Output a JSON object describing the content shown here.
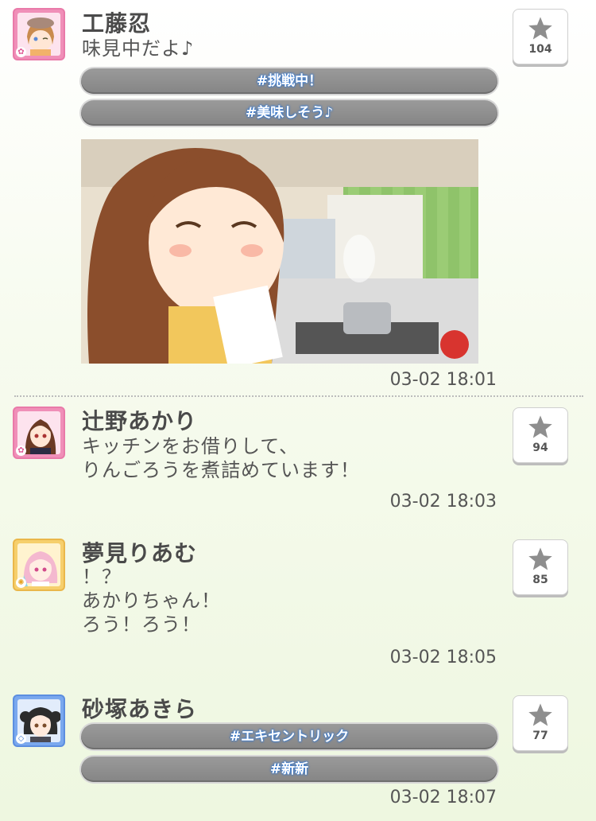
{
  "posts": [
    {
      "name": "工藤忍",
      "message": "味見中だよ♪",
      "tags": [
        "#挑戦中！",
        "#美味しそう♪"
      ],
      "favorites": "104",
      "time": "03-02 18:01",
      "avatar_color": "#f08fb8"
    },
    {
      "name": "辻野あかり",
      "message": "キッチンをお借りして、\nりんごろうを煮詰めています！",
      "tags": [],
      "favorites": "94",
      "time": "03-02 18:03",
      "avatar_color": "#f08fb8"
    },
    {
      "name": "夢見りあむ",
      "message": "！？\nあかりちゃん！\nろう！ろう！",
      "tags": [],
      "favorites": "85",
      "time": "03-02 18:05",
      "avatar_color": "#f6cf6c"
    },
    {
      "name": "砂塚あきら",
      "message": "",
      "tags": [
        "#エキセントリック",
        "#新新"
      ],
      "favorites": "77",
      "time": "03-02 18:07",
      "avatar_color": "#7aa8ee"
    }
  ],
  "icons": {
    "favorite": "star-icon"
  }
}
